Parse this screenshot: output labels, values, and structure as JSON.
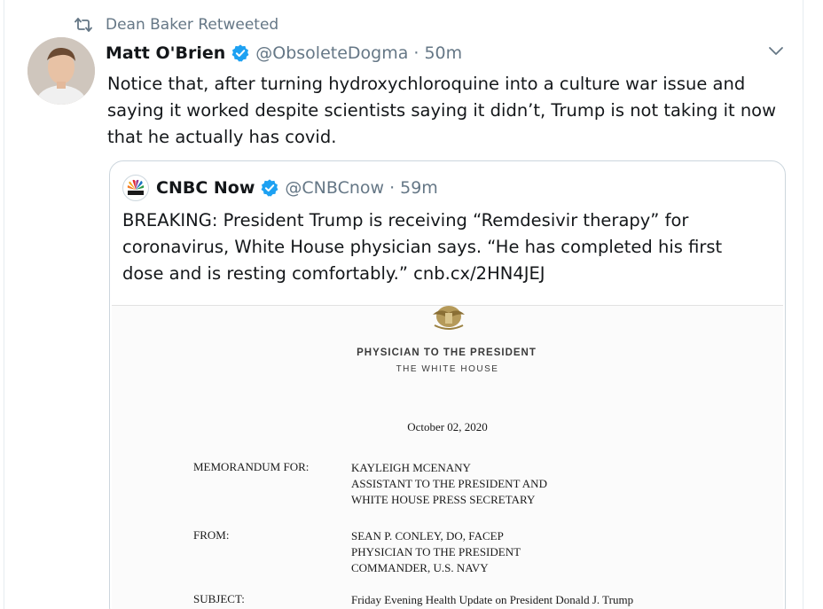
{
  "retweet": {
    "label": "Dean Baker Retweeted",
    "icon": "retweet-icon"
  },
  "tweet": {
    "author_name": "Matt O'Brien",
    "handle": "@ObsoleteDogma",
    "separator": "·",
    "time": "50m",
    "text": "Notice that, after turning hydroxychloroquine into a culture war issue and saying it worked despite scientists saying it didn’t, Trump is not taking it now that he actually has covid."
  },
  "quote": {
    "author_name": "CNBC Now",
    "handle": "@CNBCnow",
    "separator": "·",
    "time": "59m",
    "text": "BREAKING: President Trump is receiving “Remdesivir therapy” for coronavirus, White House physician says. “He has completed his first dose and is resting comfortably.” cnb.cx/2HN4JEJ"
  },
  "memo": {
    "title": "PHYSICIAN TO THE PRESIDENT",
    "subtitle": "THE WHITE HOUSE",
    "date": "October 02, 2020",
    "for_label": "MEMORANDUM FOR:",
    "for_lines": [
      "KAYLEIGH MCENANY",
      "ASSISTANT TO THE PRESIDENT AND",
      "WHITE HOUSE PRESS SECRETARY"
    ],
    "from_label": "FROM:",
    "from_lines": [
      "SEAN P. CONLEY, DO, FACEP",
      "PHYSICIAN TO THE PRESIDENT",
      "COMMANDER, U.S. NAVY"
    ],
    "subject_label": "SUBJECT:",
    "subject": "Friday Evening Health Update on President Donald J. Trump"
  },
  "colors": {
    "verified": "#1da1f2",
    "secondary_text": "#657786",
    "border": "#ccd6dd"
  }
}
